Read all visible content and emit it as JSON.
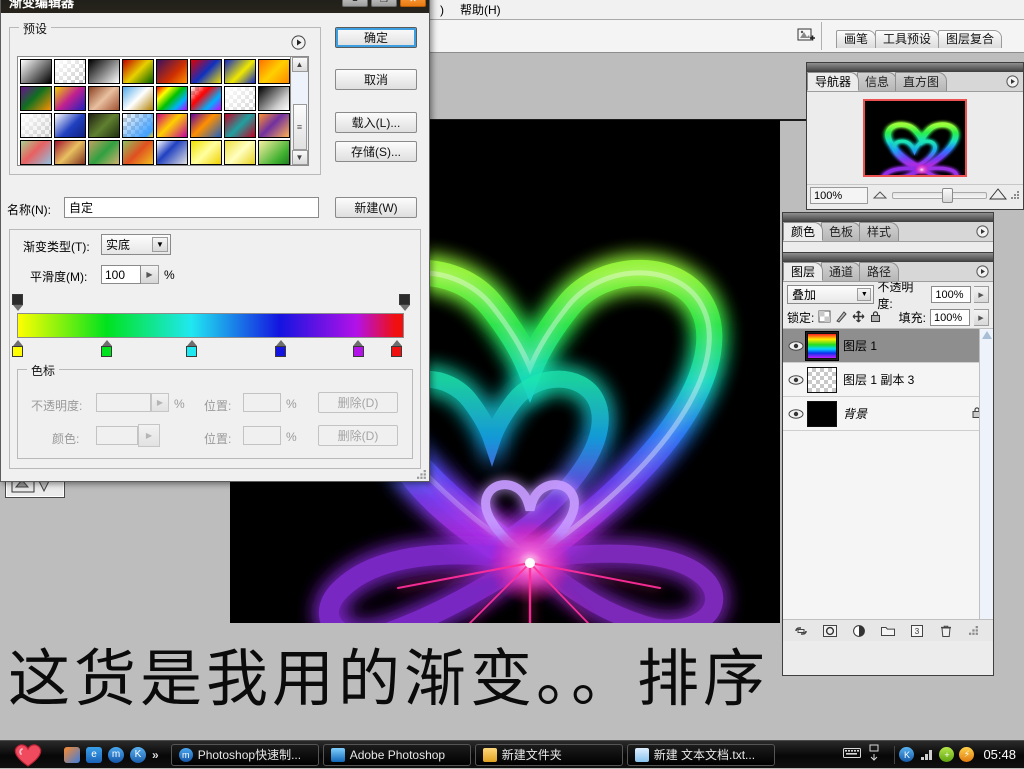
{
  "dialog": {
    "title": "渐变编辑器",
    "preset_group_label": "预设",
    "name_label": "名称(N):",
    "name_value": "自定",
    "type_label": "渐变类型(T):",
    "type_value": "实底",
    "smooth_label": "平滑度(M):",
    "smooth_value": "100",
    "percent": "%",
    "stops_group_label": "色标",
    "opacity_label": "不透明度:",
    "color_label": "颜色:",
    "position_label": "位置:",
    "delete_label": "删除(D)",
    "buttons": {
      "ok": "确定",
      "cancel": "取消",
      "load": "载入(L)...",
      "save": "存储(S)...",
      "new": "新建(W)"
    },
    "window_buttons": {
      "minimize": "–",
      "maximize": "❐",
      "close": "✕"
    },
    "gradient_stops": [
      {
        "position": 0,
        "color": "#ffff00",
        "name": "yellow"
      },
      {
        "position": 23,
        "color": "#00e21e",
        "name": "green"
      },
      {
        "position": 45,
        "color": "#20e8f0",
        "name": "cyan"
      },
      {
        "position": 68,
        "color": "#1414e0",
        "name": "blue"
      },
      {
        "position": 88,
        "color": "#b312e8",
        "name": "magenta"
      },
      {
        "position": 98,
        "color": "#f01010",
        "name": "red"
      }
    ],
    "opacity_stops": [
      {
        "position": 0,
        "color": "#2b2b2b"
      },
      {
        "position": 100,
        "color": "#2b2b2b"
      }
    ],
    "presets": [
      "linear-gradient(135deg,#ffffff 0%,#000000 100%)",
      "linear-gradient(135deg,#ffffff 0%,rgba(255,255,255,0) 100%)",
      "linear-gradient(135deg,#000000 0%,#ffffff 100%)",
      "linear-gradient(135deg,#c00000 0%,#e8d000 50%,#006000 100%)",
      "linear-gradient(135deg,#3a1060 0%,#d03000 60%,#ff9000 100%)",
      "linear-gradient(135deg,#e00000 0%,#1030c0 50%,#f0e000 100%)",
      "linear-gradient(135deg,#1028c8 0%,#f0e800 55%,#1028c8 100%)",
      "linear-gradient(135deg,#ff7000 0%,#ffd000 50%,#ff8800 100%)",
      "linear-gradient(135deg,#6a1090 0%,#107020 45%,#ff9000 100%)",
      "linear-gradient(135deg,#f0d000 0%,#c02090 50%,#2020c0 100%)",
      "linear-gradient(135deg,#8a4020 0%,#e8c0a0 50%,#a05030 100%)",
      "linear-gradient(135deg,#50a8e8 0%,#ffffff 50%,#b08000 100%)",
      "linear-gradient(135deg,#ff0000 0%,#ffff00 25%,#00c000 50%,#00b0ff 75%,#c000ff 100%)",
      "linear-gradient(135deg,rgba(255,255,255,0) 0%,#ff0000 35%,#00b0ff 70%,#d000ff 100%)",
      "linear-gradient(135deg,#ffffff 0%,rgba(255,255,255,0.25) 100%)",
      "linear-gradient(135deg,#000000 0%,#cccccc 70%,#ffffff 100%)",
      "linear-gradient(135deg,#ffffff 0%,rgba(200,200,200,0.3) 100%)",
      "linear-gradient(135deg,#ffffff 0%,#2040c0 55%,#102080 100%)",
      "linear-gradient(135deg,#202010 0%,#608030 50%,#203010 100%)",
      "linear-gradient(135deg,rgba(255,255,255,0) 0%,#40a0ff 85%,#ffcc00 100%)",
      "linear-gradient(135deg,#d00080 0%,#ffd000 45%,#c000a0 100%)",
      "linear-gradient(135deg,#6000a0 0%,#ff9000 45%,#2060c0 100%)",
      "linear-gradient(135deg,#c00020 0%,#20a0a0 50%,#c00020 100%)",
      "linear-gradient(135deg,#ff9030 0%,#7030a0 45%,#ffb050 100%)",
      "linear-gradient(135deg,#a8d090 0%,#e86060 45%,#90c0e0 100%)",
      "linear-gradient(135deg,#a01030 0%,#e8c060 50%,#803020 100%)",
      "linear-gradient(135deg,#c0a060 0%,#30a040 50%,#d0b070 100%)",
      "linear-gradient(135deg,#90c060 0%,#e05020 50%,#f0c020 100%)",
      "linear-gradient(135deg,#ffffff 0%,#2040c0 40%,#e0e0e0 100%)",
      "linear-gradient(135deg,#f0e000 0%,#ffffa0 50%,#f0d000 100%)",
      "linear-gradient(135deg,#f0e040 0%,#ffffc0 50%,#e8d020 100%)",
      "linear-gradient(135deg,#f8f0a0 0%,#40b030 70%,#208020 100%)"
    ]
  },
  "menubar": {
    "items": [
      "帮助(H)"
    ]
  },
  "palette_well": {
    "tabs": [
      "画笔",
      "工具预设",
      "图层复合"
    ]
  },
  "navigator": {
    "tabs": [
      "导航器",
      "信息",
      "直方图"
    ],
    "active_tab": "导航器",
    "zoom": "100%"
  },
  "color_panel": {
    "tabs": [
      "颜色",
      "色板",
      "样式"
    ],
    "active_tab": "颜色"
  },
  "layers_panel": {
    "tabs": [
      "图层",
      "通道",
      "路径"
    ],
    "active_tab": "图层",
    "blend_mode": "叠加",
    "opacity_label": "不透明度:",
    "opacity_value": "100%",
    "lock_label": "锁定:",
    "fill_label": "填充:",
    "fill_value": "100%",
    "layers": [
      {
        "name": "图层 1",
        "visible": true,
        "selected": true,
        "thumb": "rainbow",
        "locked": false
      },
      {
        "name": "图层 1 副本 3",
        "visible": true,
        "selected": false,
        "thumb": "transparent",
        "locked": false
      },
      {
        "name": "背景",
        "visible": true,
        "selected": false,
        "thumb": "black",
        "locked": true
      }
    ]
  },
  "caption": {
    "text": "这货是我用的渐变。。排序"
  },
  "taskbar": {
    "tasks": [
      {
        "label": "Photoshop快速制...",
        "icon_color": "#1a66c0"
      },
      {
        "label": "Adobe Photoshop",
        "icon_color": "#2a7fd0"
      },
      {
        "label": "新建文件夹",
        "icon_color": "#e8b14a"
      },
      {
        "label": "新建 文本文档.txt...",
        "icon_color": "#6fb3e8"
      }
    ],
    "quicklaunch": [
      "show-desktop-icon",
      "ie-icon",
      "maxthon-icon",
      "kingsoft-icon"
    ],
    "more": "»",
    "clock": "05:48",
    "tray": [
      "kingsoft-icon",
      "network-icon",
      "antivirus-icon",
      "shield-icon"
    ]
  },
  "artwork": {
    "description": "neon glowing heart, green to cyan to blue to purple gradient on black"
  }
}
